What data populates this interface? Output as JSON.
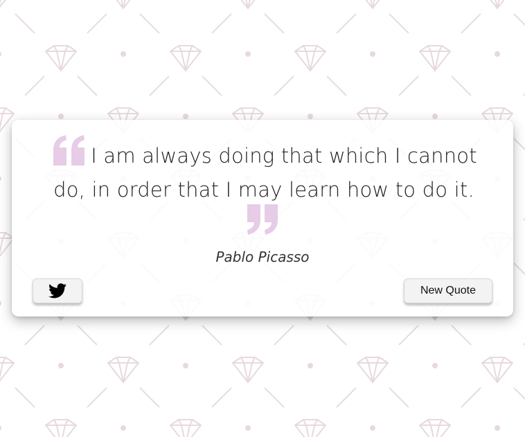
{
  "quote": {
    "text": "I am always doing that which I cannot do, in order that I may learn how to do it.",
    "author": "Pablo Picasso",
    "open_mark_icon": "open-quote-icon",
    "close_mark_icon": "close-quote-icon",
    "mark_color": "#e6cce6"
  },
  "actions": {
    "tweet_icon": "twitter-icon",
    "new_quote_label": "New Quote"
  },
  "theme": {
    "background": "#ffffff",
    "pattern_color": "#e8dce2",
    "pattern_icon": "diamond-icon"
  }
}
